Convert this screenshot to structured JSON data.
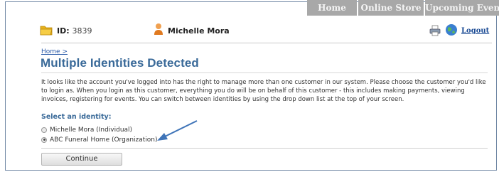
{
  "nav": {
    "tabs": [
      {
        "label": "Home"
      },
      {
        "label": "Online Store"
      },
      {
        "label": "Upcoming Events"
      }
    ]
  },
  "header": {
    "id_label": "ID:",
    "id_value": "3839",
    "user_name": "Michelle Mora",
    "logout_label": "Logout",
    "icons": [
      "folder-icon",
      "user-icon",
      "print-icon",
      "globe-icon"
    ]
  },
  "page": {
    "breadcrumb": "Home >",
    "title": "Multiple Identities Detected",
    "description": "It looks like the account you've logged into has the right to manage more than one customer in our system. Please choose the customer you'd like to login as. When you login as this customer, everything you do will be on behalf of this customer - this includes making payments, viewing invoices, registering for events. You can switch between identities by using the drop down list at the top of your screen.",
    "select_label": "Select an identity:",
    "options": [
      {
        "label": "Michelle Mora (Individual)",
        "selected": false
      },
      {
        "label": "ABC Funeral Home (Organization)",
        "selected": true
      }
    ],
    "continue_label": "Continue"
  },
  "colors": {
    "title": "#3a6a99",
    "tab_bg": "#a8a8a8",
    "link": "#1a4a94",
    "annotation_arrow": "#3f74b8"
  }
}
